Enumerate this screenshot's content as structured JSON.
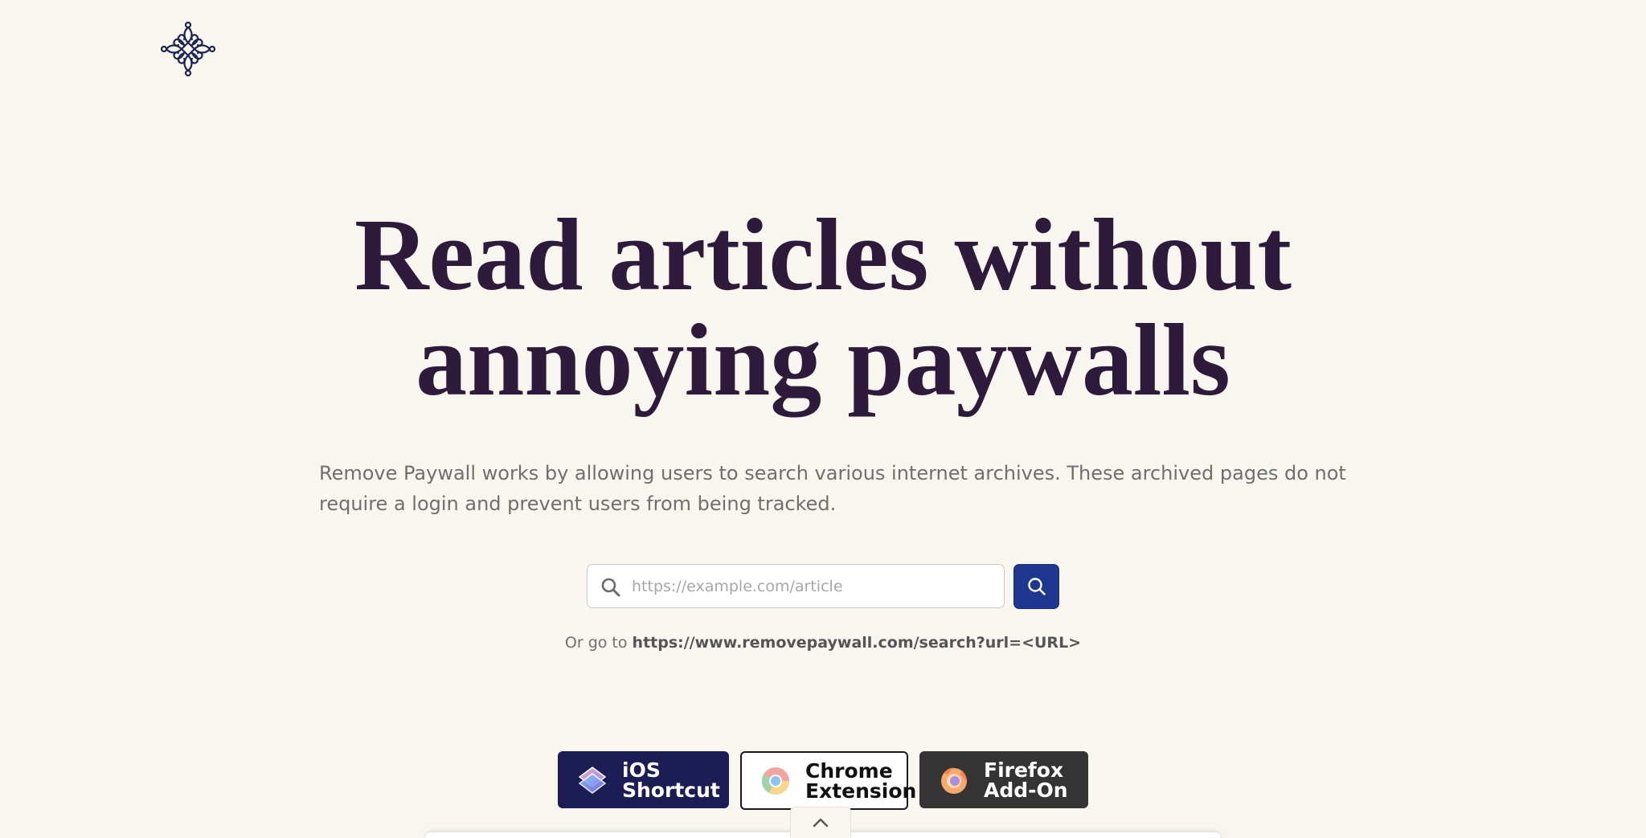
{
  "site": {
    "logo_icon": "ornament-logo-icon"
  },
  "hero": {
    "headline_line1": "Read articles without",
    "headline_line2": "annoying paywalls",
    "description": "Remove Paywall works by allowing users to search various internet archives. These archived pages do not require a login and prevent users from being tracked."
  },
  "search": {
    "placeholder": "https://example.com/article",
    "value": "",
    "input_icon": "search-icon",
    "button_icon": "search-icon",
    "or_prefix": "Or go to",
    "or_url": "https://www.removepaywall.com/search?url=<URL>"
  },
  "downloads": [
    {
      "label": "iOS\nShortcut",
      "icon": "ios-shortcuts-icon"
    },
    {
      "label": "Chrome\nExtension",
      "icon": "chrome-icon"
    },
    {
      "label": "Firefox\nAdd-On",
      "icon": "firefox-icon"
    }
  ],
  "footer": {
    "toggle_icon": "chevron-up-icon"
  },
  "colors": {
    "background": "#f8f6ef",
    "headline": "#2e1a3a",
    "accent": "#1f3790",
    "ios_bg": "#1c1d55",
    "firefox_bg": "#343434"
  }
}
